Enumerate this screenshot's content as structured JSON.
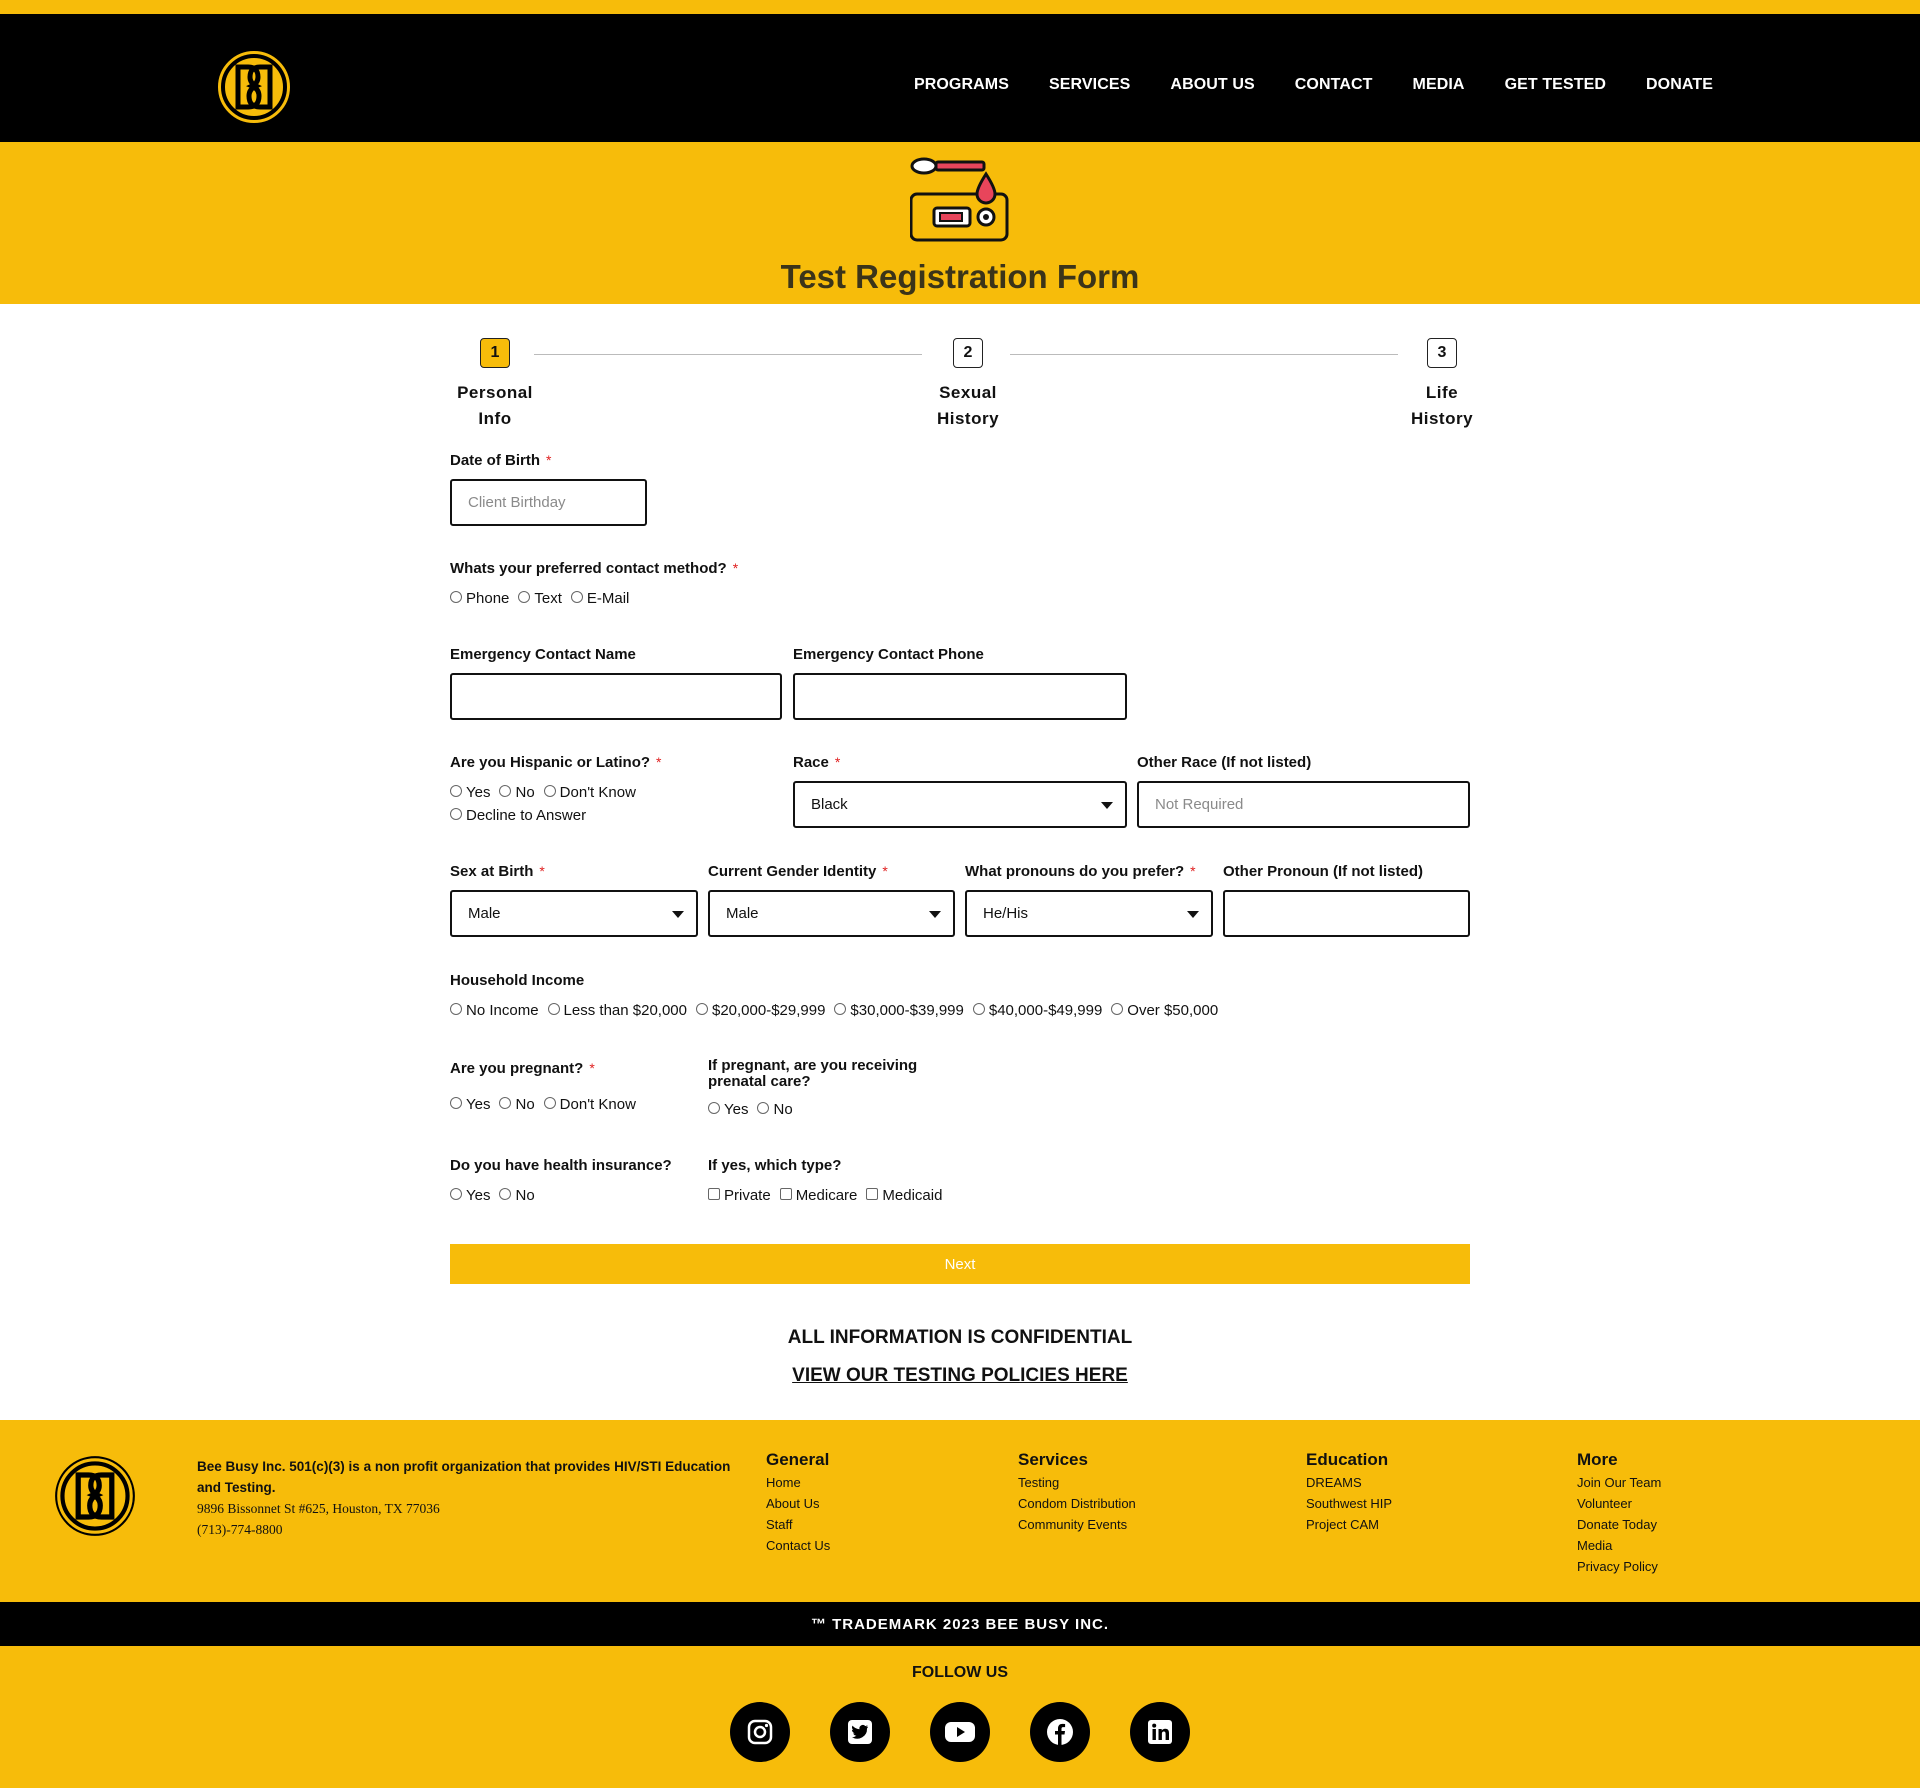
{
  "brand": {
    "logo_alt": "BB",
    "accent": "#F7BC0A"
  },
  "nav": [
    "PROGRAMS",
    "SERVICES",
    "ABOUT US",
    "CONTACT",
    "MEDIA",
    "GET TESTED",
    "DONATE"
  ],
  "hero": {
    "title": "Test Registration Form",
    "icon": "test-kit-icon"
  },
  "steps": [
    {
      "num": "1",
      "label": "Personal Info",
      "active": true
    },
    {
      "num": "2",
      "label": "Sexual History",
      "active": false
    },
    {
      "num": "3",
      "label": "Life History",
      "active": false
    }
  ],
  "form": {
    "dob": {
      "label": "Date of Birth",
      "placeholder": "Client Birthday"
    },
    "contact_method": {
      "label": "Whats your preferred contact method?",
      "options": [
        "Phone",
        "Text",
        "E-Mail"
      ]
    },
    "emergency_name": {
      "label": "Emergency Contact Name",
      "value": ""
    },
    "emergency_phone": {
      "label": "Emergency Contact Phone",
      "value": ""
    },
    "hispanic": {
      "label": "Are you Hispanic or Latino?",
      "options": [
        "Yes",
        "No",
        "Don't Know",
        "Decline to Answer"
      ]
    },
    "race": {
      "label": "Race",
      "value": "Black"
    },
    "other_race": {
      "label": "Other Race (If not listed)",
      "placeholder": "Not Required"
    },
    "sex_birth": {
      "label": "Sex at Birth",
      "value": "Male"
    },
    "gender": {
      "label": "Current Gender Identity",
      "value": "Male"
    },
    "pronouns": {
      "label": "What pronouns do you prefer?",
      "value": "He/His"
    },
    "other_pronoun": {
      "label": "Other Pronoun (If not listed)",
      "value": ""
    },
    "income": {
      "label": "Household Income",
      "options": [
        "No Income",
        "Less than $20,000",
        "$20,000-$29,999",
        "$30,000-$39,999",
        "$40,000-$49,999",
        "Over $50,000"
      ]
    },
    "pregnant": {
      "label": "Are you pregnant?",
      "options": [
        "Yes",
        "No",
        "Don't Know"
      ]
    },
    "prenatal": {
      "label": "If pregnant, are you receiving prenatal care?",
      "options": [
        "Yes",
        "No"
      ]
    },
    "insurance": {
      "label": "Do you have health insurance?",
      "options": [
        "Yes",
        "No"
      ]
    },
    "insurance_type": {
      "label": "If yes, which type?",
      "options": [
        "Private",
        "Medicare",
        "Medicaid"
      ]
    },
    "required_mark": "*",
    "next_label": "Next"
  },
  "notice": {
    "confidential": "ALL INFORMATION IS CONFIDENTIAL",
    "policies": "VIEW OUR TESTING POLICIES HERE"
  },
  "footer": {
    "about_bold": "Bee Busy Inc. 501(c)(3) is a non profit organization that provides HIV/STI Education and Testing.",
    "address": "9896 Bissonnet St #625, Houston, TX 77036",
    "phone": "(713)-774-8800",
    "columns": [
      {
        "heading": "General",
        "links": [
          "Home",
          "About Us",
          "Staff",
          "Contact Us"
        ]
      },
      {
        "heading": "Services",
        "links": [
          "Testing",
          "Condom Distribution",
          "Community Events"
        ]
      },
      {
        "heading": "Education",
        "links": [
          "DREAMS",
          "Southwest HIP",
          "Project CAM"
        ]
      },
      {
        "heading": "More",
        "links": [
          "Join Our Team",
          "Volunteer",
          "Donate Today",
          "Media",
          "Privacy Policy"
        ]
      }
    ],
    "trademark": "™ TRADEMARK 2023 BEE BUSY INC.",
    "follow": "FOLLOW US",
    "social_icons": [
      "instagram-icon",
      "twitter-icon",
      "youtube-icon",
      "facebook-icon",
      "linkedin-icon"
    ]
  }
}
